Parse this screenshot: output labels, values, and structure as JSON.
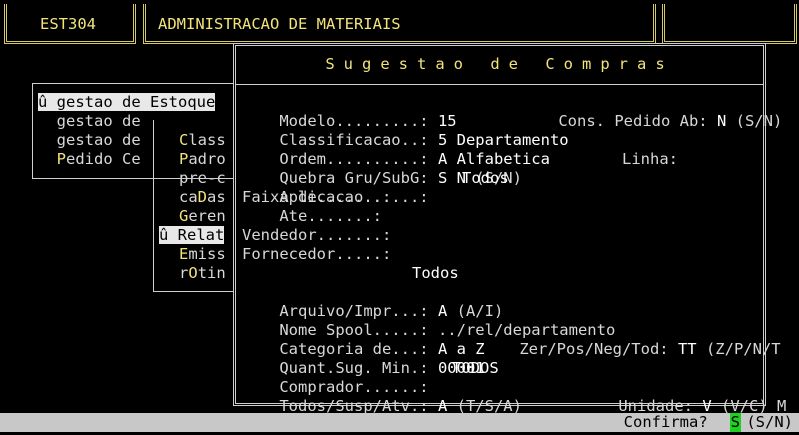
{
  "header": {
    "module_code": "EST304",
    "app_title": "ADMINISTRACAO DE MATERIAIS"
  },
  "menu1": {
    "items": [
      {
        "prefix": "û ",
        "label": "gestao de Estoque",
        "selected": true
      },
      {
        "prefix": "  ",
        "label": "gestao de",
        "selected": false
      },
      {
        "prefix": "  ",
        "label": "gestao de",
        "selected": false
      },
      {
        "prefix": "  ",
        "hot": "P",
        "label": "edido Ce",
        "selected": false
      }
    ]
  },
  "menu2": {
    "items": [
      {
        "hot": "C",
        "label": "lass"
      },
      {
        "hot": "P",
        "label": "adro"
      },
      {
        "pre": "pre-c",
        "label": ""
      },
      {
        "pre": "ca",
        "hot": "D",
        "label": "as"
      },
      {
        "hot": "G",
        "label": "eren"
      },
      {
        "pre": "û Relat",
        "label": "",
        "selected": true
      },
      {
        "hot": "E",
        "label": "miss"
      },
      {
        "pre": "r",
        "hot": "O",
        "label": "tin"
      }
    ]
  },
  "dialog": {
    "title": "Sugestao de Compras",
    "fields": {
      "modelo_label": "Modelo.........: ",
      "modelo_value": "15",
      "cons_label": "Cons. Pedido Ab: ",
      "cons_value": "N",
      "cons_opts": " (S/N)",
      "classif_label": "Classificacao..: ",
      "classif_value": "5 Departamento",
      "ordem_label": "Ordem..........: ",
      "ordem_value": "A Alfabetica",
      "quebra_label": "Quebra Gru/SubG: ",
      "quebra_value": "S N",
      "quebra_opts": " (S/N)",
      "linha_label": "Linha:",
      "aplic_label": "Aplicacao......: ",
      "aplic_value": "Todos",
      "faixa_label": "Faixa de.......: ",
      "ate_label": "    Ate.......: ",
      "vendedor_label": "Vendedor.......: ",
      "fornecedor_label": "Fornecedor.....: ",
      "fornecedor_value": "Todos",
      "arquivo_label": "Arquivo/Impr...: ",
      "arquivo_value": "A",
      "arquivo_opts": " (A/I)",
      "spool_label": "Nome Spool.....: ",
      "spool_value": "../rel/departamento",
      "categoria_label": "Categoria de...: ",
      "categoria_value": "A a Z",
      "zer_label": "Zer/Pos/Neg/Tod: ",
      "zer_value": "TT",
      "zer_opts": " (Z/P/N/T",
      "quant_label": "Quant.Sug. Min.: ",
      "quant_value": "00001",
      "comprador_label": "Comprador......: ",
      "comprador_value": "TODOS",
      "todos_label": "Todos/Susp/Atv.: ",
      "todos_value": "A",
      "todos_opts": " (T/S/A)",
      "unidade_label": "Unidade: ",
      "unidade_value": "V",
      "unidade_opts": " (V/C) M"
    }
  },
  "status": {
    "confirm_label": "Confirma? ",
    "confirm_value": "S",
    "confirm_opts": " (S/N)"
  },
  "colors": {
    "accent_yellow": "#f2e37a",
    "confirm_green": "#20d020",
    "statusbar_gray": "#c8c8c8"
  }
}
